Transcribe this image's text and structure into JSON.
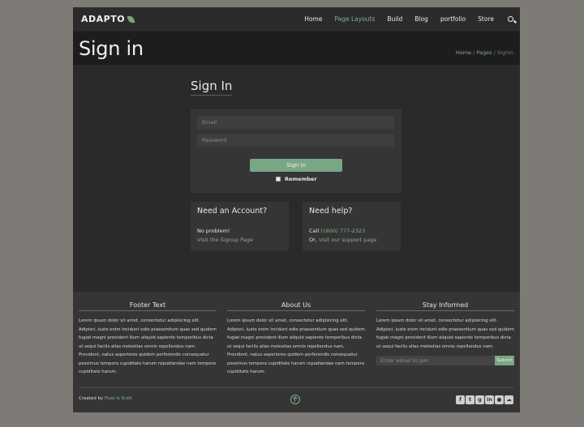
{
  "nav": {
    "brand": "ADAPTO",
    "items": [
      {
        "label": "Home",
        "active": false
      },
      {
        "label": "Page Layouts",
        "active": true
      },
      {
        "label": "Build",
        "active": false
      },
      {
        "label": "Blog",
        "active": false
      },
      {
        "label": "portfolio",
        "active": false
      },
      {
        "label": "Store",
        "active": false
      }
    ],
    "search_icon": "search-icon"
  },
  "hero": {
    "title": "Sign in",
    "breadcrumb": {
      "home": "Home",
      "sep1": "/",
      "pages": "Pages",
      "sep2": "/",
      "current": "Signin"
    }
  },
  "signin": {
    "title": "Sign In",
    "email_placeholder": "Email",
    "password_placeholder": "Password",
    "button": "Sign in",
    "remember": "Remember"
  },
  "account_card": {
    "title": "Need an Account?",
    "line1": "No problem!",
    "link": "Visit the Signup Page"
  },
  "help_card": {
    "title": "Need help?",
    "call_prefix": "Call",
    "phone": "(1800) 777-2323",
    "or_prefix": "Or,",
    "support_link": "visit our support page"
  },
  "footer": {
    "col1": {
      "title": "Footer Text",
      "text": "Lorem ipsum dolor sit amet, consectetur adipisicing elit. Adipisci, iusto enim incidunt odio praesentium quas sed quidem fugiat magni provident illum aliquid sapiente temporibus dicta ut sequi facilis alias molestias omnis repellendus nam. Provident, natus asperiores quidem perferendis consequatur possimus tempora cupiditate harum repudiandae nam tempora cupiditate harum."
    },
    "col2": {
      "title": "About Us",
      "text": "Lorem ipsum dolor sit amet, consectetur adipisicing elit. Adipisci, iusto enim incidunt odio praesentium quas sed quidem fugiat magni provident illum aliquid sapiente temporibus dicta ut sequi facilis alias molestias omnis repellendus nam. Provident, natus asperiores quidem perferendis consequatur possimus tempora cupiditate harum repudiandae nam tempora cupiditate harum."
    },
    "col3": {
      "title": "Stay Informed",
      "text": "Lorem ipsum dolor sit amet, consectetur adipisicing elit. Adipisci, iusto enim incidunt odio praesentium quas sed quidem fugiat magni provident illum aliquid sapiente temporibus dicta ut sequi facilis alias molestias omnis repellendus nam.",
      "email_placeholder": "Enter email to join",
      "submit": "Submit"
    },
    "credit_prefix": "Created by",
    "credit_link": "Pixel & Kraft",
    "socials": [
      "facebook-icon",
      "twitter-icon",
      "google-plus-icon",
      "linkedin-icon",
      "github-icon",
      "soundcloud-icon"
    ]
  },
  "colors": {
    "accent": "#7aa683",
    "background": "#2a2a2a",
    "hero": "#1d1d1d",
    "footer": "#353535"
  }
}
